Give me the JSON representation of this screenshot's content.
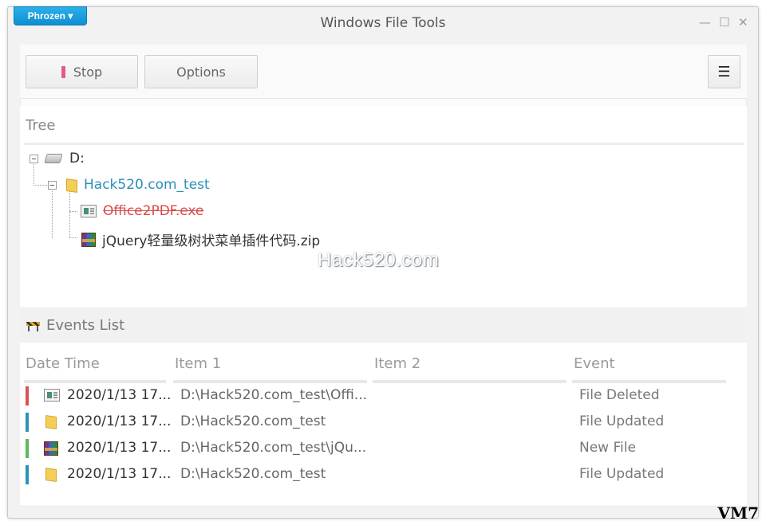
{
  "window": {
    "brand_menu": "Phrozen ▾",
    "title": "Windows File Tools",
    "controls": {
      "minimize": "—",
      "maximize": "☐",
      "close": "✕"
    }
  },
  "toolbar": {
    "stop_label": "Stop",
    "options_label": "Options",
    "menu_icon": "☰"
  },
  "tree": {
    "title": "Tree",
    "nodes": [
      {
        "label": "D:",
        "icon": "drive-icon",
        "color": "#333333"
      },
      {
        "label": "Hack520.com_test",
        "icon": "folder-icon",
        "color": "#2a8fb8"
      },
      {
        "label": "Office2PDF.exe",
        "icon": "exe-icon",
        "color": "#d84a4a",
        "deleted": true
      },
      {
        "label": "jQuery轻量级树状菜单插件代码.zip",
        "icon": "zip-icon",
        "color": "#333333"
      }
    ]
  },
  "watermark": "Hack520.com",
  "events": {
    "title": "Events List",
    "columns": [
      "Date Time",
      "Item 1",
      "Item 2",
      "Event"
    ],
    "rows": [
      {
        "status_color": "#d9534f",
        "icon": "exe-icon",
        "datetime": "2020/1/13 17...",
        "item1": "D:\\Hack520.com_test\\Offi...",
        "item2": "",
        "event": "File Deleted"
      },
      {
        "status_color": "#2a93b8",
        "icon": "folder-icon",
        "datetime": "2020/1/13 17...",
        "item1": "D:\\Hack520.com_test",
        "item2": "",
        "event": "File Updated"
      },
      {
        "status_color": "#5cb85c",
        "icon": "zip-icon",
        "datetime": "2020/1/13 17...",
        "item1": "D:\\Hack520.com_test\\jQu...",
        "item2": "",
        "event": "New File"
      },
      {
        "status_color": "#2a93b8",
        "icon": "folder-icon",
        "datetime": "2020/1/13 17...",
        "item1": "D:\\Hack520.com_test",
        "item2": "",
        "event": "File Updated"
      }
    ]
  },
  "corner_tag": "VM7"
}
